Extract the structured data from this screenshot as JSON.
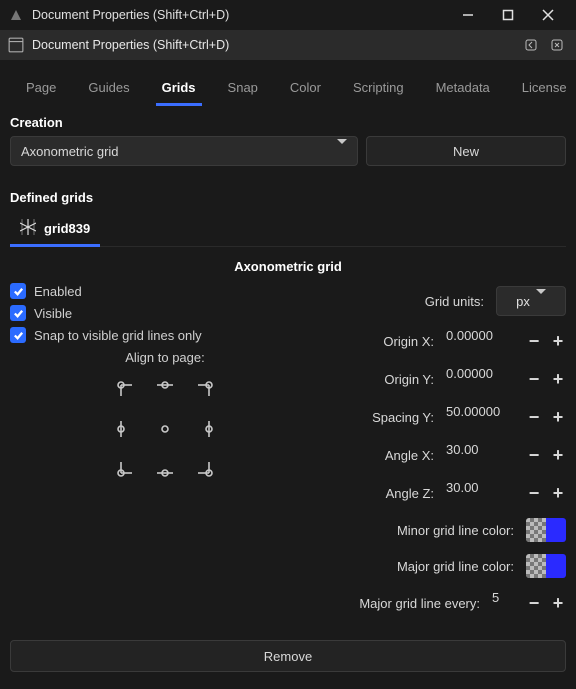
{
  "os_title": "Document Properties (Shift+Ctrl+D)",
  "dialog_title": "Document Properties (Shift+Ctrl+D)",
  "tabs": [
    "Page",
    "Guides",
    "Grids",
    "Snap",
    "Color",
    "Scripting",
    "Metadata",
    "License"
  ],
  "active_tab": "Grids",
  "creation_label": "Creation",
  "grid_type_selected": "Axonometric grid",
  "new_button": "New",
  "defined_grids_label": "Defined grids",
  "defined_grid_tab": "grid839",
  "grid_body_title": "Axonometric grid",
  "checks": {
    "enabled": "Enabled",
    "visible": "Visible",
    "snap_visible": "Snap to visible grid lines only"
  },
  "align_label": "Align to page:",
  "props": {
    "grid_units_label": "Grid units:",
    "grid_units_value": "px",
    "origin_x_label": "Origin X:",
    "origin_x_value": "0.00000",
    "origin_y_label": "Origin Y:",
    "origin_y_value": "0.00000",
    "spacing_y_label": "Spacing Y:",
    "spacing_y_value": "50.00000",
    "angle_x_label": "Angle X:",
    "angle_x_value": "30.00",
    "angle_z_label": "Angle Z:",
    "angle_z_value": "30.00",
    "minor_color_label": "Minor grid line color:",
    "minor_color_value": "#2a2aff",
    "major_color_label": "Major grid line color:",
    "major_color_value": "#2a2aff",
    "major_every_label": "Major grid line every:",
    "major_every_value": "5"
  },
  "remove_button": "Remove"
}
